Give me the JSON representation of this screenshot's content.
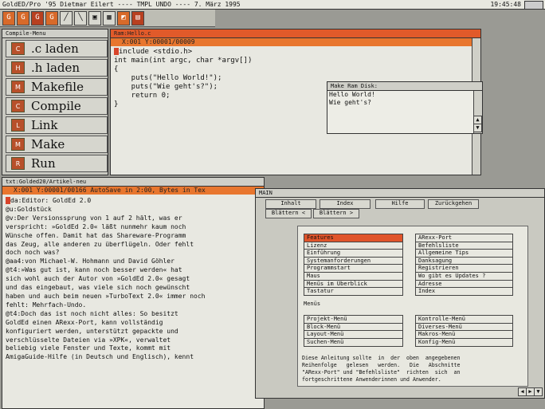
{
  "screen": {
    "title": "GoldED/Pro '95 Dietmar Eilert ---- TMPL UNDO ---- 7. März 1995",
    "clock": "19:45:48"
  },
  "toolbar": {
    "icons": [
      "g-icon",
      "g-icon",
      "g-icon",
      "g-icon",
      "bars-icon",
      "bars-icon",
      "box-icon",
      "grid-icon",
      "diagonal-icon",
      "page-icon"
    ]
  },
  "compile_menu": {
    "title": "Compile-Menu",
    "buttons": [
      {
        "icon": "c-icon",
        "label": ".c laden"
      },
      {
        "icon": "h-icon",
        "label": ".h laden"
      },
      {
        "icon": "make-icon",
        "label": "Makefile"
      },
      {
        "icon": "compile-icon",
        "label": "Compile"
      },
      {
        "icon": "link-icon",
        "label": "Link"
      },
      {
        "icon": "m-icon",
        "label": "Make"
      },
      {
        "icon": "r-icon",
        "label": "Run"
      }
    ]
  },
  "hello_editor": {
    "title": "Ram:Hello.c",
    "status": "X:001 Y:00001/00009",
    "lines": [
      "include <stdio.h>",
      "",
      "int main(int argc, char *argv[])",
      "{",
      "    puts(\"Hello World!\");",
      "    puts(\"Wie geht's?\");",
      "",
      "    return 0;",
      "}"
    ]
  },
  "shell": {
    "title": "Make  Ram Disk:",
    "lines": [
      "Hello World!",
      "Wie geht's?"
    ]
  },
  "article_editor": {
    "title": "txt:Golded20/Artikel-neu",
    "status": "X:001 Y:00001/00166 AutoSave in 2:00, Bytes in Tex",
    "lines": [
      "da:Editor: GoldEd 2.0",
      "",
      "@u:Goldstück",
      "",
      "@v:Der Versionssprung von 1 auf 2 hält, was er",
      "verspricht: »GoldEd 2.0« läßt nunmehr kaum noch",
      "Wünsche offen. Damit hat das Shareware-Programm",
      "das Zeug, alle anderen zu überflügeln. Oder fehlt",
      "doch noch was?",
      "",
      "@aa4:von Michael-W. Hohmann und David Göhler",
      "",
      "@t4:»Was gut ist, kann noch besser werden« hat",
      "sich wohl auch der Autor von »GoldEd 2.0« gesagt",
      "und das eingebaut, was viele sich noch gewünscht",
      "haben und auch beim neuen »TurboText 2.0« immer noch",
      "fehlt: Mehrfach-Undo.",
      "",
      "@t4:Doch das ist noch nicht alles: So besitzt",
      "GoldEd einen ARexx-Port, kann vollständig",
      "konfiguriert werden, unterstützt gepackte und",
      "verschlüsselte Dateien via »XPK«, verwaltet",
      "beliebig viele Fenster und Texte, kommt mit",
      "AmigaGuide-Hilfe (in Deutsch und Englisch), kennt"
    ]
  },
  "main_guide": {
    "title": "MAIN",
    "nav": [
      "Inhalt",
      "Index",
      "Hilfe",
      "Zurückgehen"
    ],
    "nav2": [
      "Blättern <",
      "Blättern >"
    ],
    "links_left": [
      "Features",
      "Lizenz",
      "Einführung",
      "Systemanforderungen",
      "Programmstart",
      "Maus",
      "Menüs im Überblick",
      "Tastatur"
    ],
    "links_right": [
      "ARexx-Port",
      "Befehlsliste",
      "Allgemeine Tips",
      "Danksagung",
      "Registrieren",
      "Wo gibt es Updates ?",
      "Adresse",
      "Index"
    ],
    "menus_label": "Menüs",
    "menus_left": [
      "Projekt-Menü",
      "Block-Menü",
      "Layout-Menü",
      "Suchen-Menü"
    ],
    "menus_right": [
      "Kontrolle-Menü",
      "Diverses-Menü",
      "Makros-Menü",
      "Konfig-Menü"
    ],
    "description": [
      "Diese Anleitung sollte  in  der  oben  angegebenen",
      "Reihenfolge   gelesen   werden.   Die   Abschnitte",
      "\"ARexx-Port\" und \"Befehlsliste\"  richten  sich  an",
      "fortgeschrittene Anwenderinnen und Anwender."
    ]
  },
  "colors": {
    "accent": "#e15a2a",
    "statusbar": "#e8762e",
    "window_bg": "#e6e6df"
  }
}
